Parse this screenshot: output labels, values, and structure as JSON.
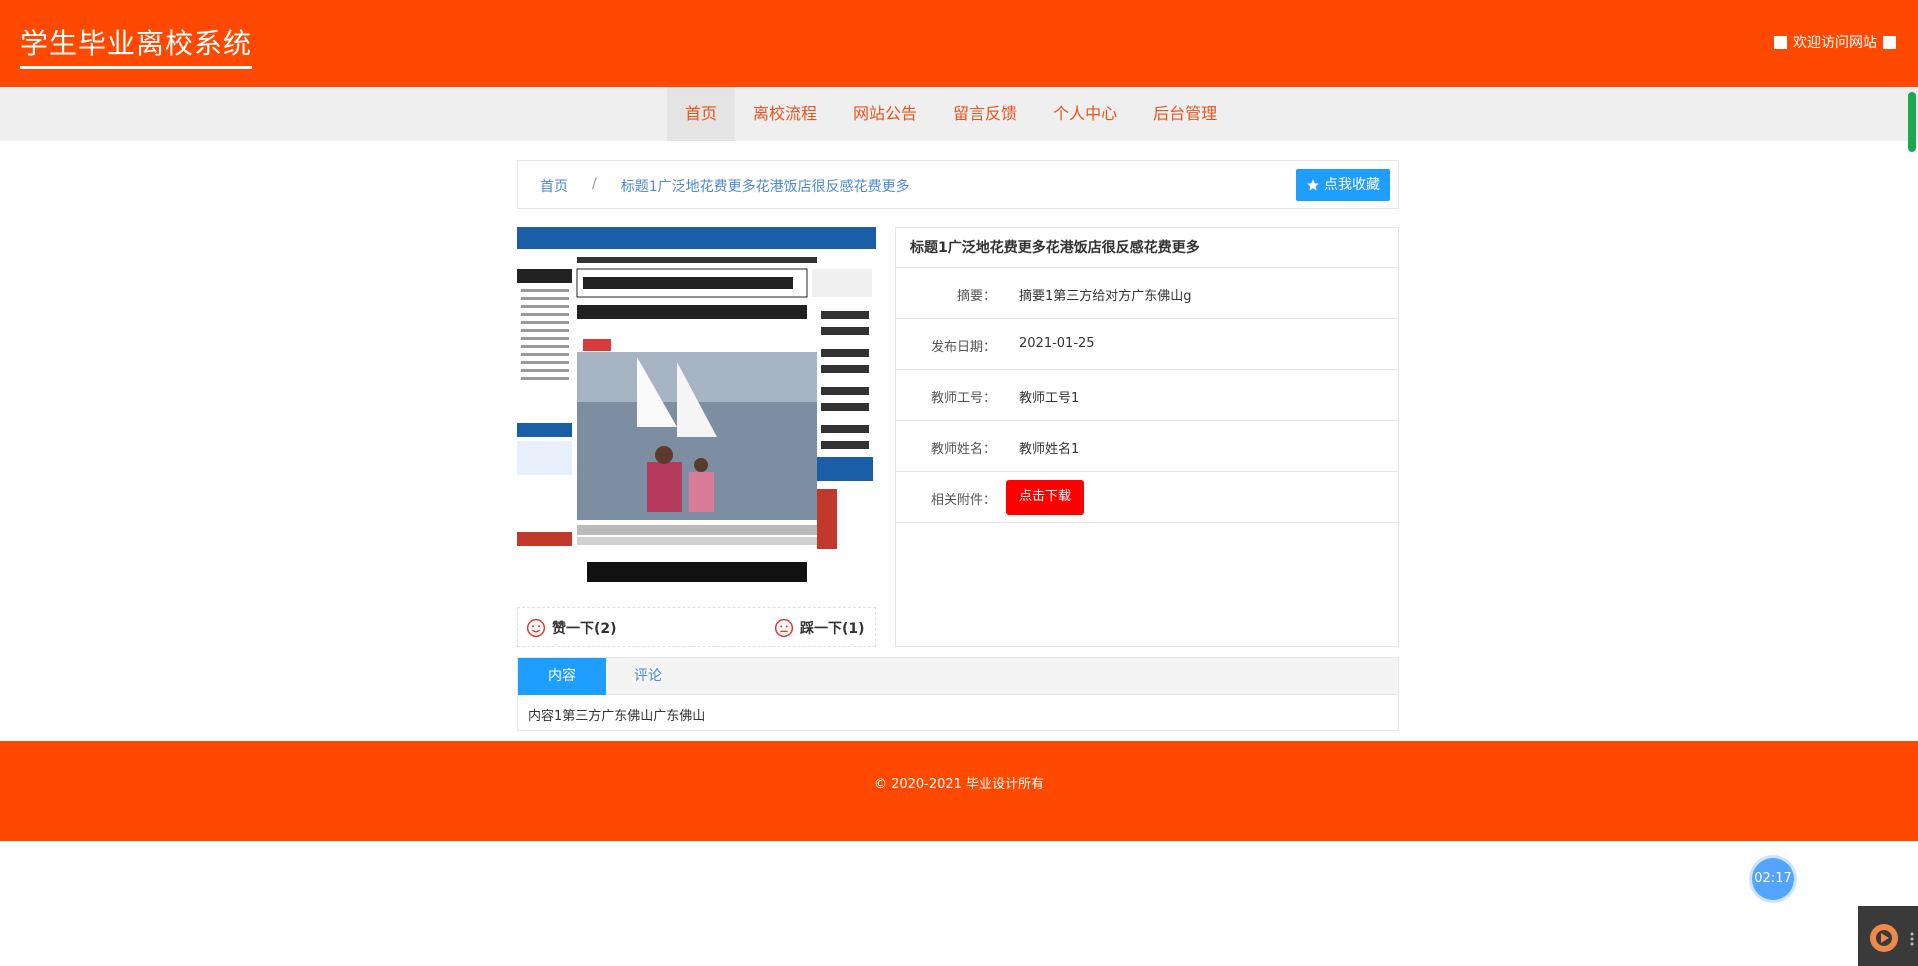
{
  "header": {
    "site_title": "学生毕业离校系统",
    "welcome": "欢迎访问网站"
  },
  "nav": {
    "items": [
      {
        "label": "首页",
        "active": true
      },
      {
        "label": "离校流程"
      },
      {
        "label": "网站公告"
      },
      {
        "label": "留言反馈"
      },
      {
        "label": "个人中心"
      },
      {
        "label": "后台管理"
      }
    ]
  },
  "breadcrumb": {
    "home": "首页",
    "separator": "/",
    "current": "标题1广泛地花费更多花港饭店很反感花费更多",
    "favorite_button": "点我收藏"
  },
  "votes": {
    "like_label": "赞一下(2)",
    "dislike_label": "踩一下(1)"
  },
  "detail": {
    "title": "标题1广泛地花费更多花港饭店很反感花费更多",
    "rows": [
      {
        "label": "摘要：",
        "value": "摘要1第三方给对方广东佛山g"
      },
      {
        "label": "发布日期：",
        "value": "2021-01-25"
      },
      {
        "label": "教师工号：",
        "value": "教师工号1"
      },
      {
        "label": "教师姓名：",
        "value": "教师姓名1"
      }
    ],
    "attachment_label": "相关附件：",
    "download_button": "点击下载"
  },
  "tabs": {
    "items": [
      {
        "label": "内容",
        "active": true
      },
      {
        "label": "评论"
      }
    ],
    "content": "内容1第三方广东佛山广东佛山"
  },
  "footer": {
    "copyright": "© 2020-2021 毕业设计所有"
  },
  "widgets": {
    "clock_time": "02:17"
  },
  "colors": {
    "brand": "#ff4800",
    "link": "#4f8ad1",
    "primary_button": "#1e9fff",
    "danger_button": "#ff0000"
  }
}
